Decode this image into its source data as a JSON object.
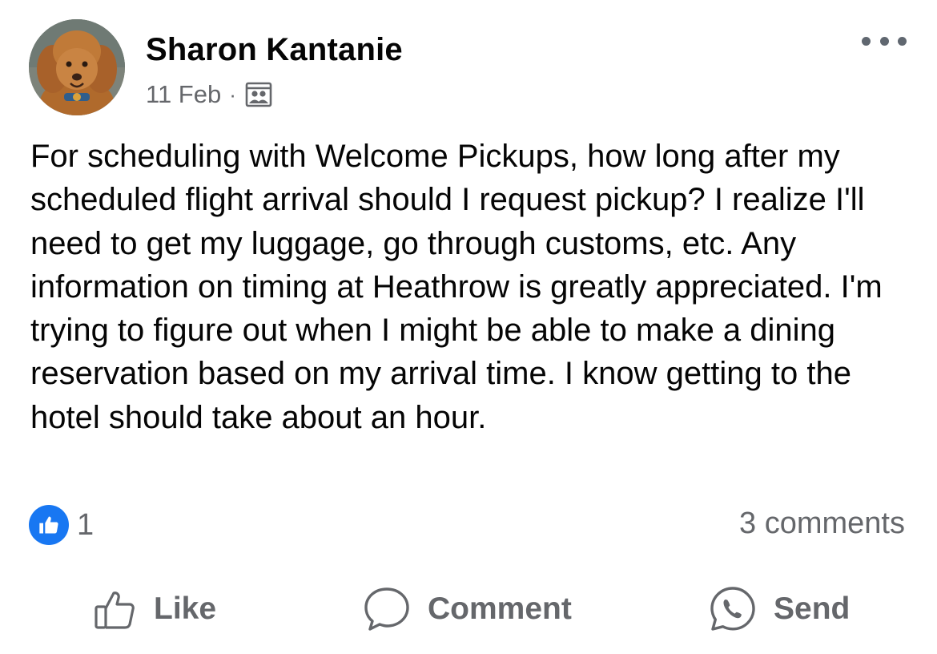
{
  "post": {
    "author": "Sharon Kantanie",
    "date": "11 Feb",
    "separator": "·",
    "audience_icon": "group-icon",
    "more_icon": "more-options-icon",
    "body": "For scheduling with Welcome Pickups, how long after my scheduled flight arrival should I request pickup? I realize I'll need to get my luggage, go through customs, etc. Any information on timing at Heathrow is greatly appreciated. I'm trying to figure out when I might be able to make a dining reservation based on my arrival time. I know getting to the hotel should take about an hour.",
    "reactions": {
      "icon": "like-reaction-icon",
      "count": "1"
    },
    "comments_count": "3 comments"
  },
  "actions": {
    "like_label": "Like",
    "comment_label": "Comment",
    "send_label": "Send"
  },
  "colors": {
    "text": "#050505",
    "secondary": "#65676b",
    "brand_blue": "#1877f2"
  }
}
